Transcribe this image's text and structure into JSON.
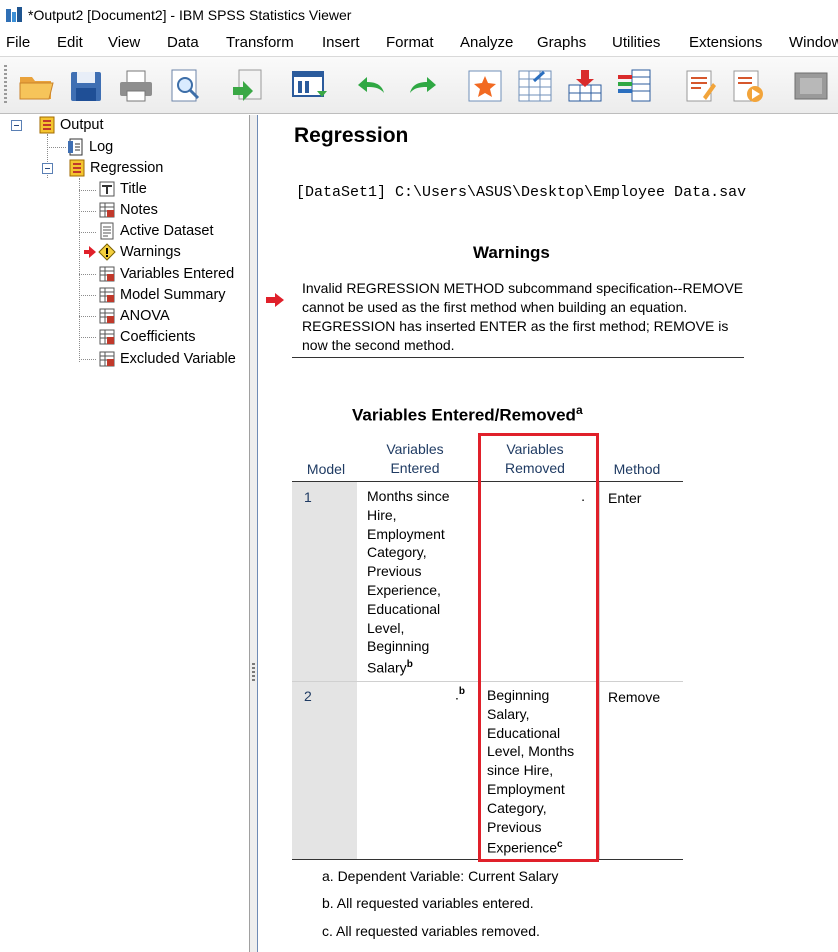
{
  "window": {
    "title": "*Output2 [Document2] - IBM SPSS Statistics Viewer"
  },
  "menu": [
    "File",
    "Edit",
    "View",
    "Data",
    "Transform",
    "Insert",
    "Format",
    "Analyze",
    "Graphs",
    "Utilities",
    "Extensions",
    "Window"
  ],
  "toolbar": {
    "icons": [
      "open-folder-icon",
      "save-icon",
      "print-icon",
      "print-preview-icon",
      "export-icon",
      "recall-dialog-icon",
      "undo-icon",
      "redo-icon",
      "goto-data-icon",
      "goto-case-icon",
      "goto-variable-icon",
      "variables-icon",
      "designate-window-icon",
      "run-script-icon",
      "insert-output-icon"
    ]
  },
  "outline": {
    "root": "Output",
    "log": "Log",
    "regression": "Regression",
    "children": [
      "Title",
      "Notes",
      "Active Dataset",
      "Warnings",
      "Variables Entered",
      "Model Summary",
      "ANOVA",
      "Coefficients",
      "Excluded Variable"
    ]
  },
  "output": {
    "heading": "Regression",
    "dataset": "[DataSet1] C:\\Users\\ASUS\\Desktop\\Employee Data.sav",
    "warnings": {
      "title": "Warnings",
      "text": "Invalid REGRESSION METHOD subcommand specification--REMOVE cannot be used as the first method when building an equation. REGRESSION has inserted ENTER as the first method; REMOVE is now the second method."
    },
    "table": {
      "title": "Variables Entered/Removed",
      "title_note": "a",
      "headers": {
        "model": "Model",
        "entered": "Variables Entered",
        "removed": "Variables Removed",
        "method": "Method"
      },
      "rows": [
        {
          "model": "1",
          "entered": "Months since Hire, Employment Category, Previous Experience, Educational Level, Beginning Salary",
          "entered_note": "b",
          "removed": ".",
          "removed_note": "",
          "method": "Enter"
        },
        {
          "model": "2",
          "entered": ".",
          "entered_note": "b",
          "removed": "Beginning Salary, Educational Level, Months since Hire, Employment Category, Previous Experience",
          "removed_note": "c",
          "method": "Remove"
        }
      ],
      "footnotes": [
        "a. Dependent Variable: Current Salary",
        "b. All requested variables entered.",
        "c. All requested variables removed."
      ]
    }
  },
  "colors": {
    "highlight_box": "#e0202a",
    "warning_arrow": "#e0202a",
    "header_text": "#1f3b63",
    "model_column": "#e4e4e4"
  }
}
